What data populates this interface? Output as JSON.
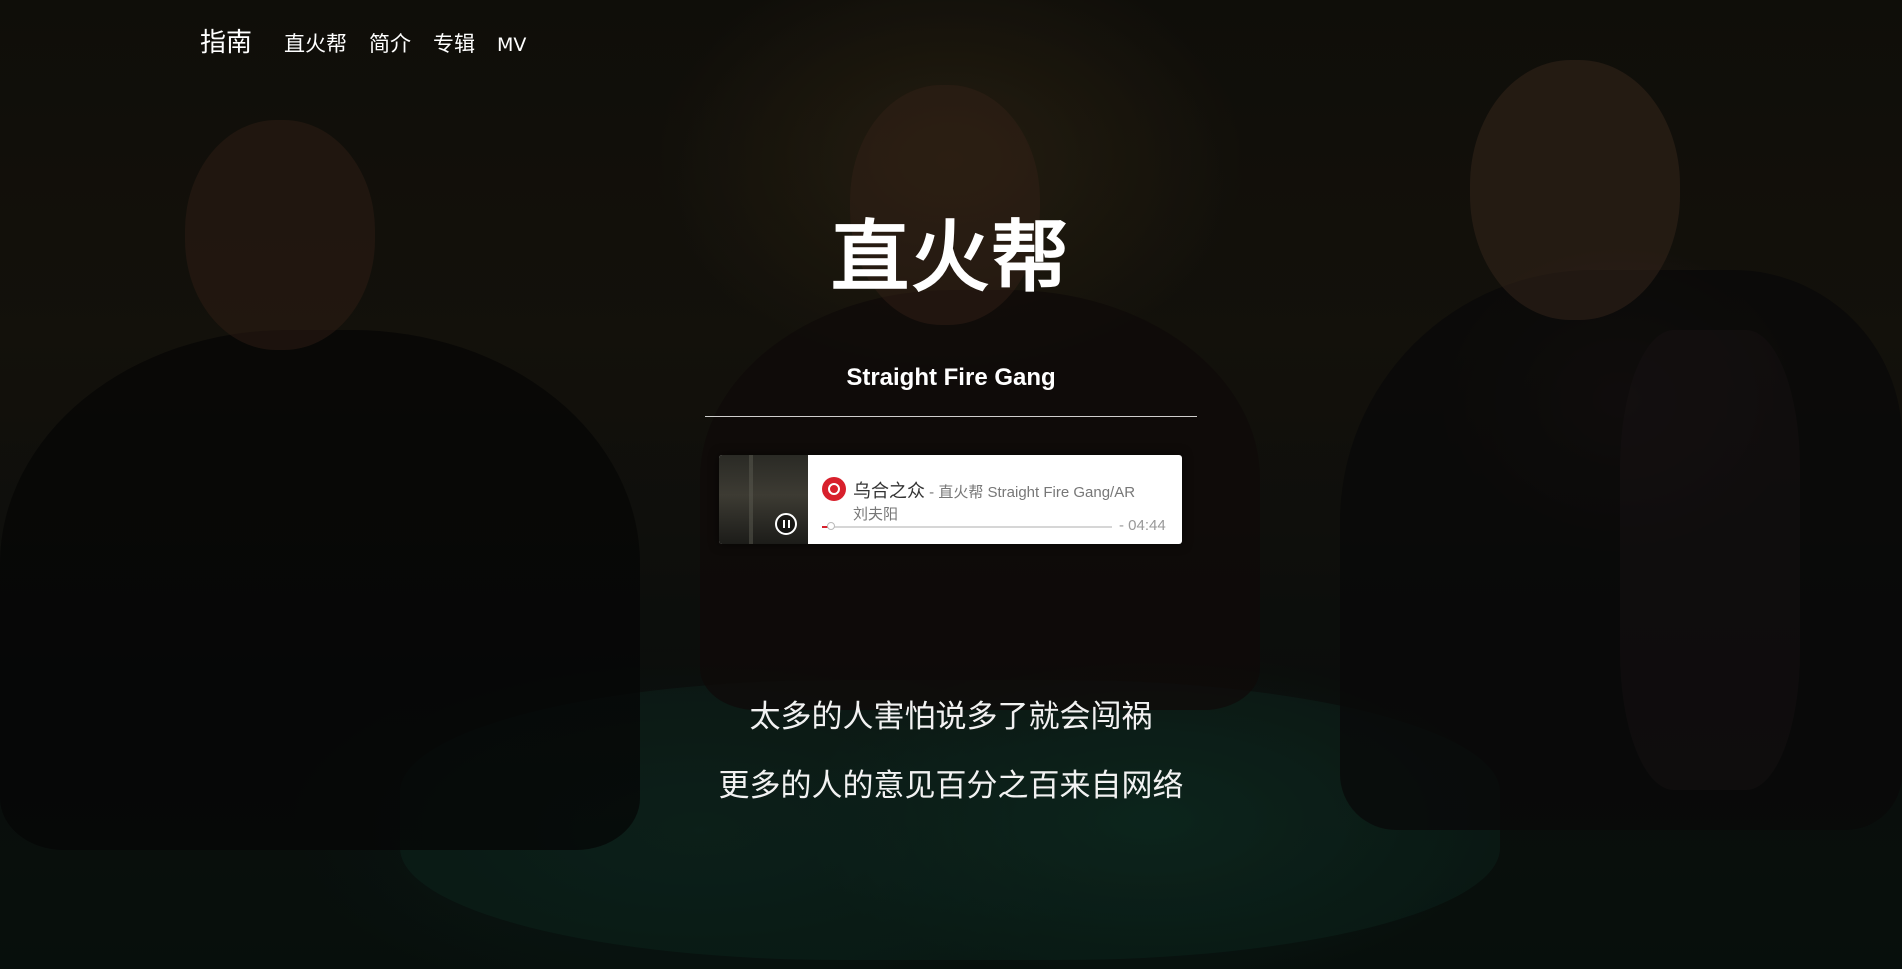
{
  "nav": {
    "brand": "指南",
    "links": [
      "直火帮",
      "简介",
      "专辑",
      "MV"
    ]
  },
  "hero": {
    "title": "直火帮",
    "subtitle": "Straight Fire Gang"
  },
  "player": {
    "song": "乌合之众",
    "artist_line": " - 直火帮 Straight Fire Gang/AR",
    "artist_line_cont": "刘夫阳",
    "time": "- 04:44",
    "progress": 0.03,
    "state": "playing",
    "accent": "#d8202c",
    "icons": [
      "netease-music-icon",
      "pause-icon"
    ]
  },
  "lyrics": [
    "太多的人害怕说多了就会闯祸",
    "更多的人的意见百分之百来自网络"
  ]
}
